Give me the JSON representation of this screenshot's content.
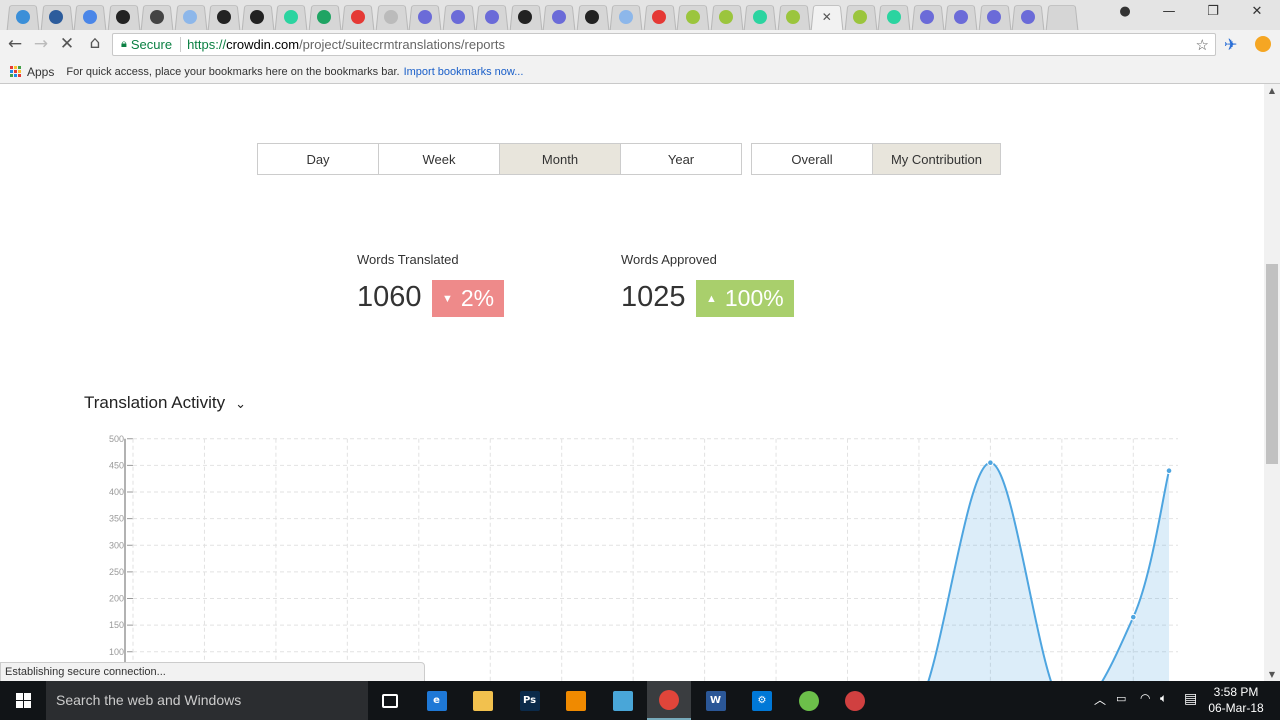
{
  "browser": {
    "tabs": [
      {
        "icon": "crowdin-icon",
        "color": "#3b8fd8"
      },
      {
        "icon": "x-icon",
        "color": "#2c5c9c"
      },
      {
        "icon": "docs-icon",
        "color": "#4a86e8"
      },
      {
        "icon": "h-icon",
        "color": "#222222"
      },
      {
        "icon": "bolt-icon",
        "color": "#444444"
      },
      {
        "icon": "crowdin-icon",
        "color": "#8db7ea"
      },
      {
        "icon": "github-icon",
        "color": "#222222"
      },
      {
        "icon": "github-icon",
        "color": "#222222"
      },
      {
        "icon": "green-circle-icon",
        "color": "#2bd4a0"
      },
      {
        "icon": "sheets-icon",
        "color": "#1fa463"
      },
      {
        "icon": "calendar-icon",
        "color": "#e53935"
      },
      {
        "icon": "page-icon",
        "color": "#bbbbbb"
      },
      {
        "icon": "orb-icon",
        "color": "#6b6bd8"
      },
      {
        "icon": "orb-icon",
        "color": "#6b6bd8"
      },
      {
        "icon": "orb-icon",
        "color": "#6b6bd8"
      },
      {
        "icon": "github-icon",
        "color": "#222222"
      },
      {
        "icon": "orb-icon",
        "color": "#6b6bd8"
      },
      {
        "icon": "github-icon",
        "color": "#222222"
      },
      {
        "icon": "crowdin-icon",
        "color": "#8db7ea"
      },
      {
        "icon": "shield-icon",
        "color": "#e53935"
      },
      {
        "icon": "leaf-icon",
        "color": "#9bc53d"
      },
      {
        "icon": "leaf-icon",
        "color": "#9bc53d"
      },
      {
        "icon": "green-circle-icon",
        "color": "#2bd4a0"
      },
      {
        "icon": "leaf-icon",
        "color": "#9bc53d"
      },
      {
        "icon": "close-icon",
        "color": "#555555",
        "active": true
      },
      {
        "icon": "leaf-icon",
        "color": "#9bc53d"
      },
      {
        "icon": "green-circle-icon",
        "color": "#2bd4a0"
      },
      {
        "icon": "orb-icon",
        "color": "#6b6bd8"
      },
      {
        "icon": "orb-icon",
        "color": "#6b6bd8"
      },
      {
        "icon": "orb-icon",
        "color": "#6b6bd8"
      },
      {
        "icon": "orb-icon",
        "color": "#6b6bd8"
      }
    ],
    "secure_label": "Secure",
    "url_scheme": "https://",
    "url_host": "crowdin.com",
    "url_path": "/project/suitecrmtranslations/reports",
    "apps_label": "Apps",
    "bookmarks_hint": "For quick access, place your bookmarks here on the bookmarks bar.",
    "import_link": "Import bookmarks now...",
    "status_text": "Establishing secure connection..."
  },
  "filters": {
    "period": [
      "Day",
      "Week",
      "Month",
      "Year"
    ],
    "period_selected": "Month",
    "scope": [
      "Overall",
      "My Contribution"
    ],
    "scope_selected": "My Contribution"
  },
  "stats": {
    "translated": {
      "label": "Words Translated",
      "value": "1060",
      "change": "2%",
      "direction": "down",
      "color": "#ee8a8a"
    },
    "approved": {
      "label": "Words Approved",
      "value": "1025",
      "change": "100%",
      "direction": "up",
      "color": "#a9cf6c"
    }
  },
  "section_title": "Translation Activity",
  "chart_data": {
    "type": "area",
    "title": "Translation Activity",
    "x": [
      0,
      1,
      2,
      3,
      4,
      5,
      6,
      7,
      8,
      9,
      10,
      11,
      12,
      13,
      14,
      14.5
    ],
    "values": [
      0,
      0,
      0,
      0,
      0,
      0,
      0,
      0,
      0,
      0,
      0,
      0,
      455,
      0,
      165,
      440
    ],
    "yticks": [
      100,
      150,
      200,
      250,
      300,
      350,
      400,
      450,
      500
    ],
    "ylim": [
      0,
      500
    ],
    "grid": true,
    "color": "#4ea5e0"
  },
  "taskbar": {
    "search_placeholder": "Search the web and Windows",
    "time": "3:58 PM",
    "date": "06-Mar-18",
    "apps": [
      {
        "name": "task-view",
        "label": "",
        "color": "#111417"
      },
      {
        "name": "edge",
        "label": "e",
        "color": "#1e78d6"
      },
      {
        "name": "file-explorer",
        "label": "",
        "color": "#f2c14e"
      },
      {
        "name": "photoshop",
        "label": "Ps",
        "color": "#0b2a4a"
      },
      {
        "name": "vlc",
        "label": "",
        "color": "#f08a00"
      },
      {
        "name": "control-panel",
        "label": "",
        "color": "#49a6d8"
      },
      {
        "name": "chrome",
        "label": "",
        "color": "#e0453a"
      },
      {
        "name": "word",
        "label": "W",
        "color": "#2b5797"
      },
      {
        "name": "settings",
        "label": "⚙",
        "color": "#0078d7"
      },
      {
        "name": "network-app",
        "label": "",
        "color": "#6cc04a"
      },
      {
        "name": "paint",
        "label": "",
        "color": "#d04040"
      }
    ]
  }
}
